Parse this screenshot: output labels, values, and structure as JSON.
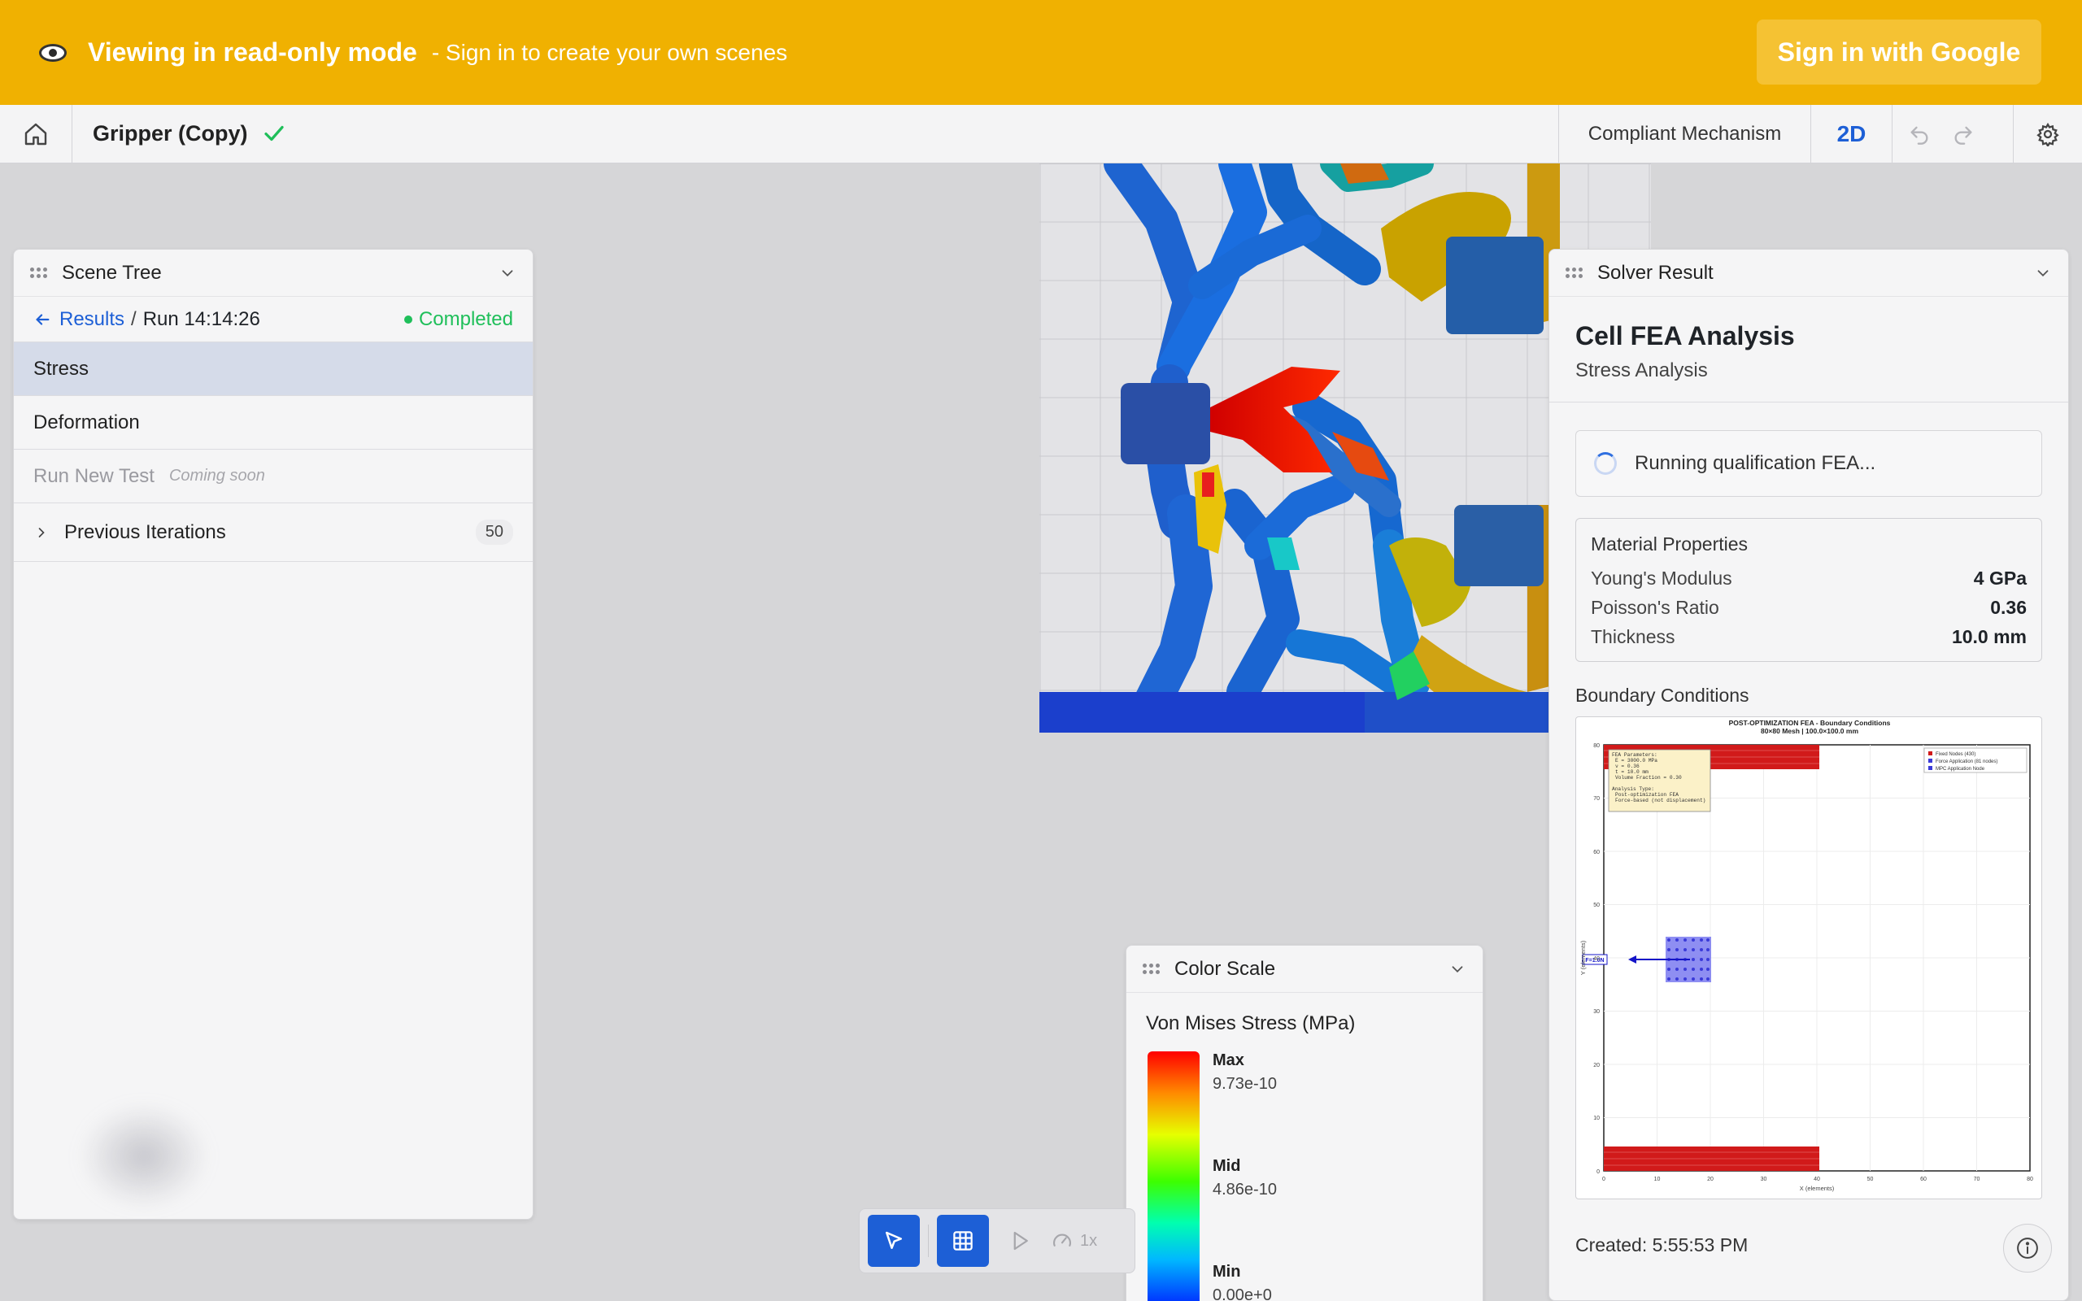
{
  "banner": {
    "title": "Viewing in read-only mode",
    "subtitle": "- Sign in to create your own scenes",
    "signin_label": "Sign in with Google"
  },
  "toolbar": {
    "scene_name": "Gripper (Copy)",
    "mode_label": "Compliant Mechanism",
    "view_label": "2D"
  },
  "scene_tree": {
    "title": "Scene Tree",
    "back_label": "Results",
    "run_label": "Run 14:14:26",
    "status": "Completed",
    "items": [
      {
        "label": "Stress"
      },
      {
        "label": "Deformation"
      },
      {
        "label": "Run New Test",
        "note": "Coming soon"
      }
    ],
    "previous": {
      "label": "Previous Iterations",
      "count": "50"
    }
  },
  "solver": {
    "title": "Solver Result",
    "heading": "Cell FEA Analysis",
    "subheading": "Stress Analysis",
    "running_label": "Running qualification FEA...",
    "material_title": "Material Properties",
    "materials": [
      {
        "k": "Young's Modulus",
        "v": "4 GPa"
      },
      {
        "k": "Poisson's Ratio",
        "v": "0.36"
      },
      {
        "k": "Thickness",
        "v": "10.0 mm"
      }
    ],
    "bc_title": "Boundary Conditions",
    "bc_plot_title": "POST-OPTIMIZATION FEA - Boundary Conditions",
    "bc_plot_subtitle": "80×80 Mesh | 100.0×100.0 mm",
    "bc_xlabel": "X (elements)",
    "bc_ylabel": "Y (elements)",
    "bc_force_label": "F=1.0N",
    "bc_legend": [
      "Fixed Nodes (430)",
      "Force Application (81 nodes)",
      "MPC Application Node"
    ],
    "bc_params_title": "FEA Parameters:",
    "bc_params": [
      "E = 3000.0 MPa",
      "ν = 0.36",
      "t = 10.0 mm",
      "Volume Fraction = 0.30"
    ],
    "bc_analysis_title": "Analysis Type:",
    "bc_analysis": [
      "Post-optimization FEA",
      "Force-based (not displacement)"
    ],
    "bc_xticks": [
      "0",
      "10",
      "20",
      "30",
      "40",
      "50",
      "60",
      "70",
      "80"
    ],
    "bc_yticks": [
      "0",
      "10",
      "20",
      "30",
      "40",
      "50",
      "60",
      "70",
      "80"
    ],
    "created": "Created: 5:55:53 PM"
  },
  "color_scale": {
    "title": "Color Scale",
    "label": "Von Mises Stress (MPa)",
    "max_label": "Max",
    "max_value": "9.73e-10",
    "mid_label": "Mid",
    "mid_value": "4.86e-10",
    "min_label": "Min",
    "min_value": "0.00e+0"
  },
  "dock": {
    "speed": "1x"
  },
  "colors": {
    "banner": "#f0b101",
    "accent": "#1d5fd6",
    "success": "#1fbf5a",
    "fixed_nodes": "#d11a1a",
    "force_nodes": "#3a3ad8"
  }
}
